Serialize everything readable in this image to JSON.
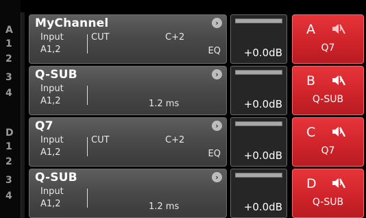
{
  "rail": {
    "groups": [
      {
        "letter": "A",
        "nums": [
          "1",
          "2",
          "3",
          "4"
        ]
      },
      {
        "letter": "D",
        "nums": [
          "1",
          "2",
          "3",
          "4"
        ]
      }
    ]
  },
  "channels": [
    {
      "name": "MyChannel",
      "input_label": "Input",
      "source": "A1,2",
      "cut": "CUT",
      "gain": "C+2",
      "eq": "EQ",
      "delay": "",
      "level": "+0.0dB",
      "out_letter": "A",
      "out_label": "Q7"
    },
    {
      "name": "Q-SUB",
      "input_label": "Input",
      "source": "A1,2",
      "cut": "",
      "gain": "",
      "eq": "",
      "delay": "1.2 ms",
      "level": "+0.0dB",
      "out_letter": "B",
      "out_label": "Q-SUB"
    },
    {
      "name": "Q7",
      "input_label": "Input",
      "source": "A1,2",
      "cut": "CUT",
      "gain": "C+2",
      "eq": "EQ",
      "delay": "",
      "level": "+0.0dB",
      "out_letter": "C",
      "out_label": "Q7"
    },
    {
      "name": "Q-SUB",
      "input_label": "Input",
      "source": "A1,2",
      "cut": "",
      "gain": "",
      "eq": "",
      "delay": "1.2 ms",
      "level": "+0.0dB",
      "out_letter": "D",
      "out_label": "Q-SUB"
    }
  ],
  "icons": {
    "arrow": "chevron-right-icon",
    "mute": "speaker-mute-icon"
  },
  "colors": {
    "tile": "#4a4a4a",
    "output_active": "#d0242b",
    "meter_bg": "#262626",
    "rail_text": "#9a9a9a"
  }
}
